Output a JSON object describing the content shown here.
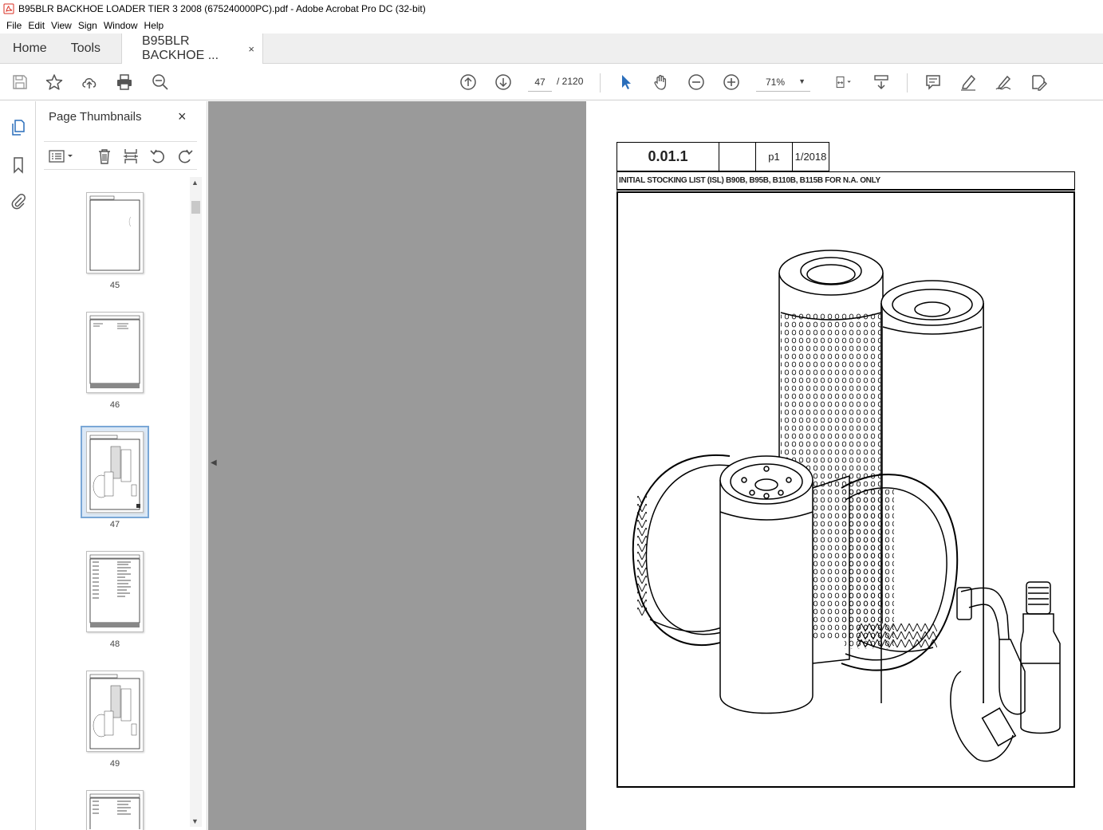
{
  "window": {
    "title": "B95BLR BACKHOE LOADER TIER 3 2008 (675240000PC).pdf - Adobe Acrobat Pro DC (32-bit)"
  },
  "menu": [
    "File",
    "Edit",
    "View",
    "Sign",
    "Window",
    "Help"
  ],
  "tabs": {
    "home": "Home",
    "tools": "Tools",
    "document": "B95BLR BACKHOE ...",
    "close_glyph": "×"
  },
  "toolbar": {
    "current_page": "47",
    "total_pages": "/  2120",
    "zoom": "71%"
  },
  "thumbnails_panel": {
    "title": "Page Thumbnails",
    "close_glyph": "×",
    "pages": [
      {
        "label": "45"
      },
      {
        "label": "46"
      },
      {
        "label": "47",
        "selected": true
      },
      {
        "label": "48"
      },
      {
        "label": "49"
      }
    ]
  },
  "document_page": {
    "section_code": "0.01.1",
    "page_ref": "p1",
    "revision_date": "1/2018",
    "caption": "INITIAL STOCKING LIST (ISL) B90B, B95B, B110B, B115B FOR N.A. ONLY"
  },
  "colors": {
    "accent_blue": "#2a6ebb",
    "gray_canvas": "#9a9a9a",
    "selected_thumb": "#7aa7d6"
  }
}
